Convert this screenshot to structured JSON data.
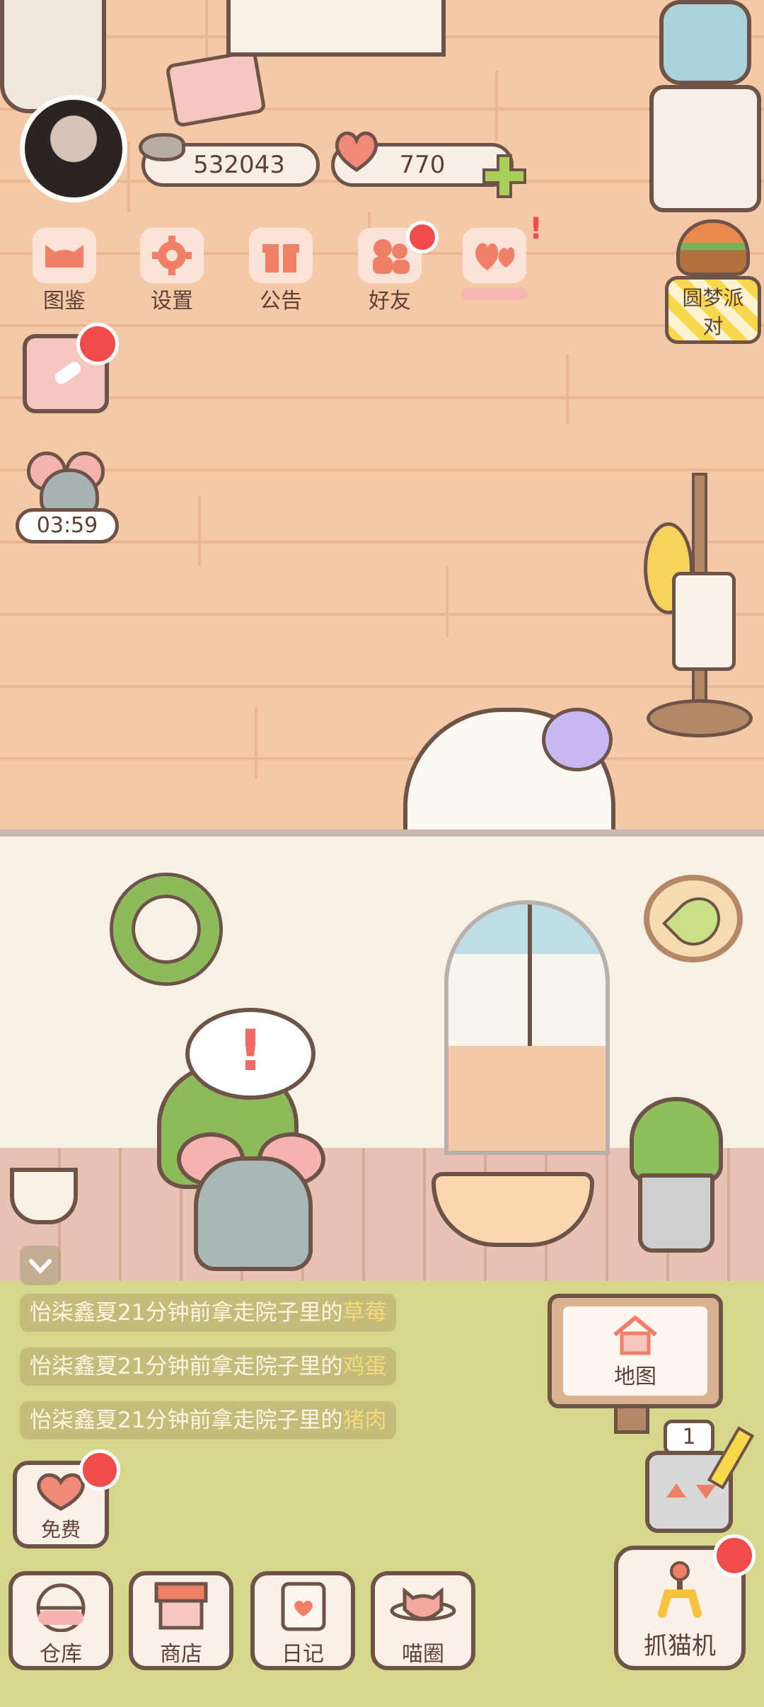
{
  "hud": {
    "fish_amount": "532043",
    "heart_amount": "770",
    "plus_icon": "plus-icon"
  },
  "menu": {
    "items": [
      {
        "label": "图鉴",
        "icon": "cat-book-icon"
      },
      {
        "label": "设置",
        "icon": "gear-icon"
      },
      {
        "label": "公告",
        "icon": "gift-icon"
      },
      {
        "label": "好友",
        "icon": "friends-icon"
      },
      {
        "label": "",
        "icon": "hearts-icon"
      }
    ]
  },
  "event": {
    "label": "圆梦派对"
  },
  "mouse_timer": "03:59",
  "activity_log": [
    {
      "text": "怡柒鑫夏21分钟前拿走院子里的",
      "item": "草莓"
    },
    {
      "text": "怡柒鑫夏21分钟前拿走院子里的",
      "item": "鸡蛋"
    },
    {
      "text": "怡柒鑫夏21分钟前拿走院子里的",
      "item": "猪肉"
    }
  ],
  "map_sign": {
    "label": "地图"
  },
  "counter": {
    "value": "1"
  },
  "free": {
    "label": "免费"
  },
  "bottom_nav": [
    {
      "label": "仓库",
      "icon": "warehouse-icon"
    },
    {
      "label": "商店",
      "icon": "shop-icon"
    },
    {
      "label": "日记",
      "icon": "diary-icon"
    },
    {
      "label": "喵圈",
      "icon": "planet-cat-icon"
    }
  ],
  "claw_machine": {
    "label": "抓猫机"
  },
  "colors": {
    "badge_red": "#f04c4c",
    "outline": "#6e5348",
    "wall": "#f5c8a6",
    "grass": "#d6d78a"
  }
}
